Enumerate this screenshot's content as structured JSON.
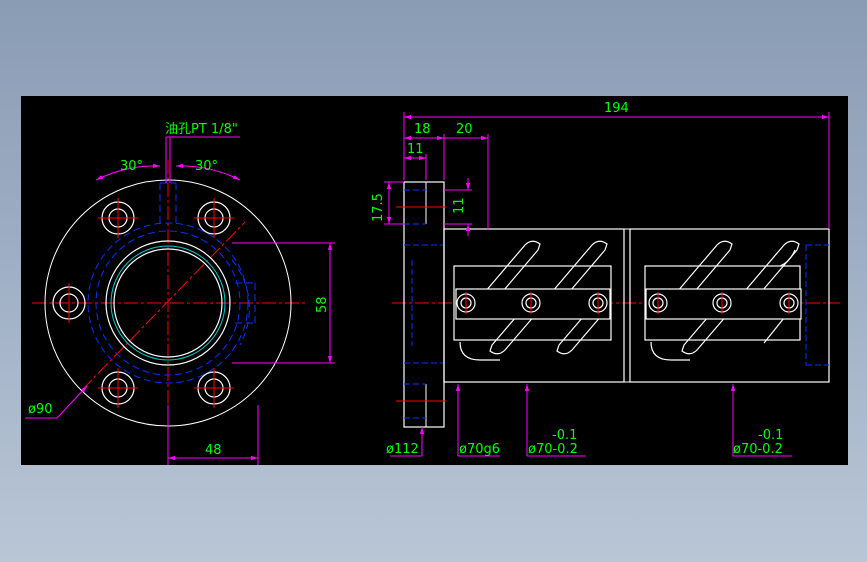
{
  "colors": {
    "background": "#000000",
    "outline": "#ffffff",
    "hidden_lines": "#0033ff",
    "dimension_lines": "#ff00ff",
    "dimension_text": "#00ff00",
    "center_lines": "#ff0000",
    "thread": "#00cccc",
    "window_gradient_top": "#8a9cb4"
  },
  "front_view": {
    "oil_hole_note": "油孔PT 1/8\"",
    "angle_left": "30°",
    "angle_right": "30°",
    "dim_bolt_circle": "ø90",
    "dim_height": "58",
    "dim_width": "48"
  },
  "side_view": {
    "dim_total_length": "194",
    "dim_flange_width": "18",
    "dim_step": "20",
    "dim_flange_inner": "11",
    "dim_oil_offset": "17.5",
    "dim_oil_depth": "11",
    "dim_flange_dia": "ø112",
    "dim_body_fit": "ø70g6",
    "dim_body_dia_1": "ø70-0.2",
    "tol_upper_1": "-0.1",
    "dim_body_dia_2": "ø70-0.2",
    "tol_upper_2": "-0.1"
  }
}
